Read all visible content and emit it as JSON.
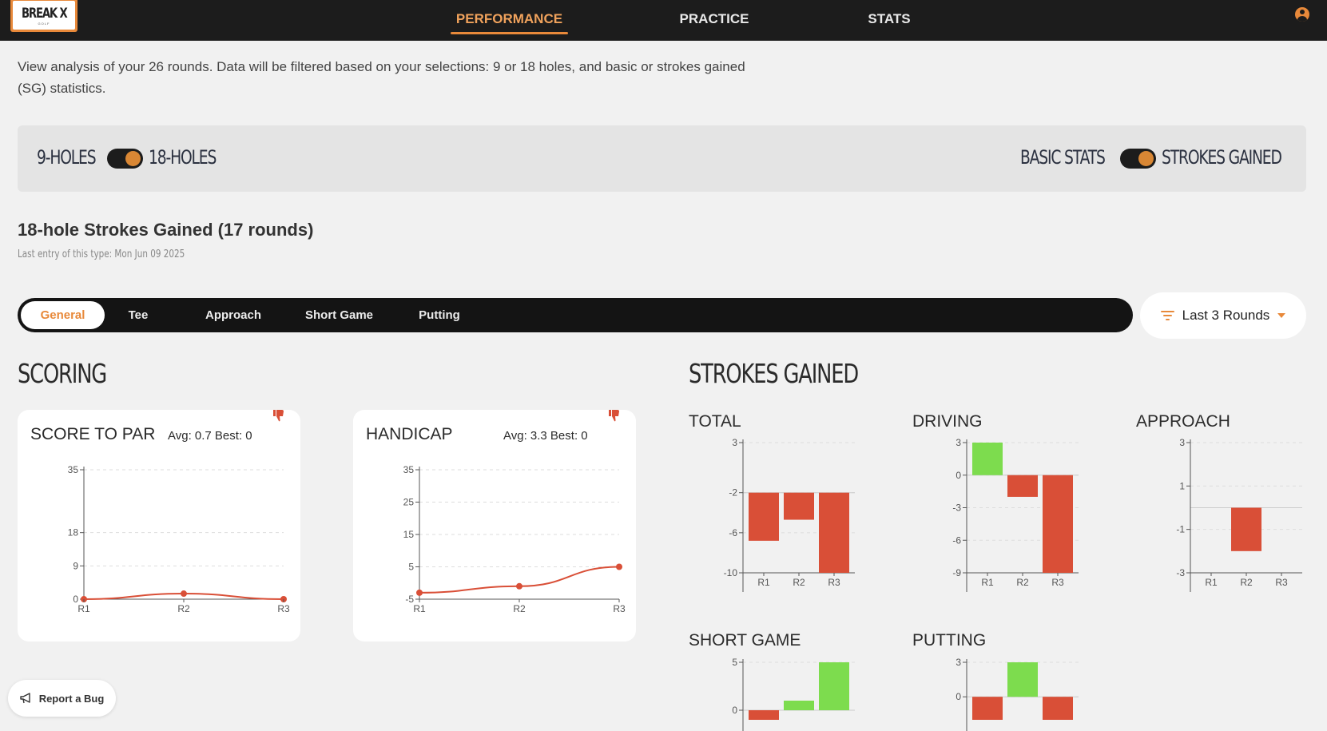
{
  "nav": {
    "logo_text": "BREAK X",
    "logo_sub": "GOLF",
    "tabs": [
      "PERFORMANCE",
      "PRACTICE",
      "STATS"
    ],
    "active_tab": "PERFORMANCE",
    "accent": "#e8893a",
    "icons": {
      "user": "user-circle-icon"
    }
  },
  "intro": "View analysis of your 26 rounds. Data will be filtered based on your selections: 9 or 18 holes, and basic or strokes gained (SG) statistics.",
  "toggles": {
    "holes_left": "9-HOLES",
    "holes_right": "18-HOLES",
    "holes_selected": "18-HOLES",
    "stats_left": "BASIC STATS",
    "stats_right": "STROKES GAINED",
    "stats_selected": "STROKES GAINED"
  },
  "section": {
    "title": "18-hole Strokes Gained (17 rounds)",
    "last_entry": "Last entry of this type: Mon Jun 09 2025"
  },
  "subtabs": {
    "items": [
      "General",
      "Tee",
      "Approach",
      "Short Game",
      "Putting"
    ],
    "active": "General"
  },
  "range": {
    "label": "Last 3 Rounds",
    "icon": "filter-icon"
  },
  "scoring": {
    "heading": "SCORING",
    "cards": [
      {
        "title": "SCORE TO PAR",
        "stats": "Avg: 0.7  Best: 0",
        "icon": "thumbs-down-icon"
      },
      {
        "title": "HANDICAP",
        "stats": "Avg: 3.3  Best: 0",
        "icon": "thumbs-down-icon"
      }
    ]
  },
  "strokes_gained": {
    "heading": "STROKES GAINED",
    "colors": {
      "positive": "#7ddc4e",
      "negative": "#d94f37",
      "line": "#d94f37"
    }
  },
  "report": {
    "label": "Report a Bug",
    "icon": "megaphone-icon"
  },
  "chart_data": [
    {
      "type": "line",
      "title": "SCORE TO PAR",
      "categories": [
        "R1",
        "R2",
        "R3"
      ],
      "values": [
        0,
        1.5,
        0
      ],
      "yticks": [
        0,
        9,
        18,
        35
      ],
      "ylim": [
        0,
        35
      ]
    },
    {
      "type": "line",
      "title": "HANDICAP",
      "categories": [
        "R1",
        "R2",
        "R3"
      ],
      "values": [
        -3,
        -1,
        5
      ],
      "yticks": [
        -5,
        5,
        15,
        25,
        35
      ],
      "ylim": [
        -5,
        35
      ]
    },
    {
      "type": "bar",
      "title": "TOTAL",
      "categories": [
        "R1",
        "R2",
        "R3"
      ],
      "values": [
        -6.8,
        -4.7,
        -10
      ],
      "yticks": [
        3,
        -2,
        -6,
        -10
      ],
      "ylim": [
        -10,
        3
      ],
      "baseline": -2
    },
    {
      "type": "bar",
      "title": "DRIVING",
      "categories": [
        "R1",
        "R2",
        "R3"
      ],
      "values": [
        3,
        -2,
        -9
      ],
      "yticks": [
        3,
        0,
        -3,
        -6,
        -9
      ],
      "ylim": [
        -9,
        3
      ]
    },
    {
      "type": "bar",
      "title": "APPROACH",
      "categories": [
        "R1",
        "R2",
        "R3"
      ],
      "values": [
        0,
        -2,
        0
      ],
      "yticks": [
        3,
        1,
        -1,
        -3
      ],
      "ylim": [
        -3,
        3
      ]
    },
    {
      "type": "bar",
      "title": "SHORT GAME",
      "categories": [
        "R1",
        "R2",
        "R3"
      ],
      "values": [
        -1,
        1,
        5
      ],
      "yticks": [
        5,
        0
      ],
      "ylim": [
        -1,
        5
      ]
    },
    {
      "type": "bar",
      "title": "PUTTING",
      "categories": [
        "R1",
        "R2",
        "R3"
      ],
      "values": [
        -2,
        3,
        -2
      ],
      "yticks": [
        3,
        0
      ],
      "ylim": [
        -2,
        3
      ]
    }
  ]
}
